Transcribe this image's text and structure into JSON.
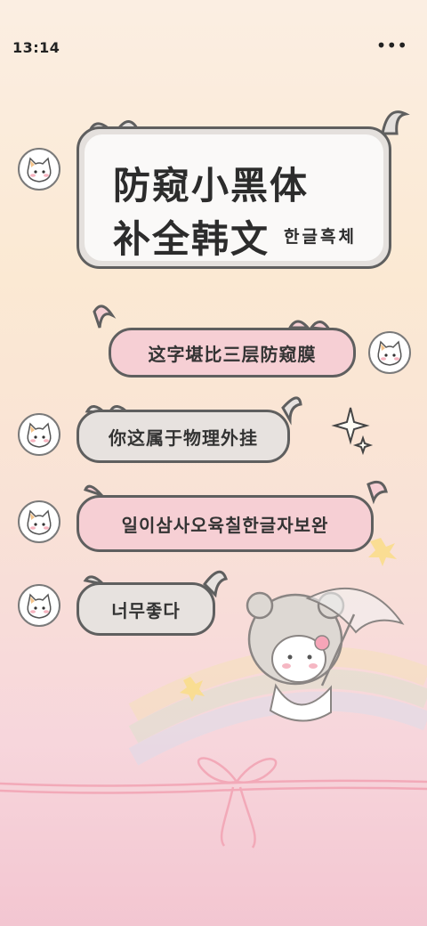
{
  "status_bar": {
    "time": "13:14",
    "menu_icon": "more-horizontal-icon"
  },
  "title_card": {
    "line1": "防窥小黑体",
    "line2": "补全韩文",
    "line3": "한글흑체"
  },
  "messages": [
    {
      "side": "left",
      "style": "title"
    },
    {
      "side": "right",
      "style": "pink",
      "text": "这字堪比三层防窥膜"
    },
    {
      "side": "left",
      "style": "grey",
      "text": "你这属于物理外挂"
    },
    {
      "side": "left",
      "style": "pink",
      "text": "일이삼사오육칠한글자보완"
    },
    {
      "side": "left",
      "style": "grey",
      "text": "너무좋다"
    }
  ],
  "colors": {
    "bubble_grey": "#e7e2df",
    "bubble_pink": "#f6cfd4",
    "outline": "#5f5f5f",
    "ribbon": "#f2a9b8"
  },
  "icons": [
    "cat-avatar-icon",
    "sparkle-icon",
    "bear-umbrella-illustration",
    "ribbon-bow-icon",
    "rainbow-decoration"
  ]
}
